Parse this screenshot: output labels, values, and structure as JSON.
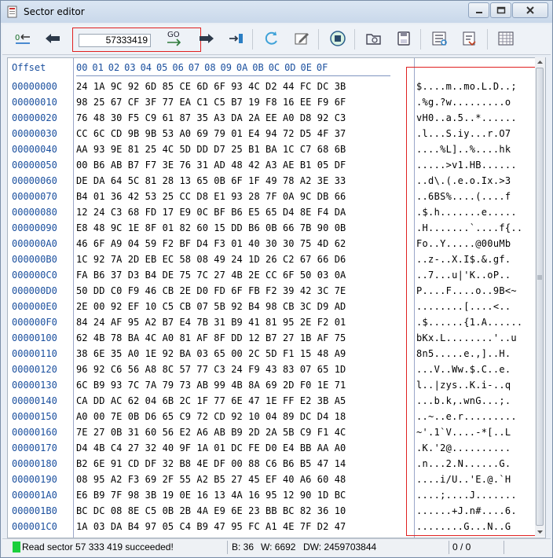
{
  "window": {
    "title": "Sector editor"
  },
  "toolbar": {
    "sector_value": "57333419",
    "go_label": "GO"
  },
  "grid": {
    "offset_header": "Offset",
    "column_headers": [
      "00",
      "01",
      "02",
      "03",
      "04",
      "05",
      "06",
      "07",
      "08",
      "09",
      "0A",
      "0B",
      "0C",
      "0D",
      "0E",
      "0F"
    ],
    "rows": [
      {
        "offset": "00000000",
        "hex": "24 1A 9C 92 6D 85 CE 6D 6F 93 4C D2 44 FC DC 3B",
        "ascii": "$....m..mo.L.D..;"
      },
      {
        "offset": "00000010",
        "hex": "98 25 67 CF 3F 77 EA C1 C5 B7 19 F8 16 EE F9 6F",
        "ascii": ".%g.?w.........o"
      },
      {
        "offset": "00000020",
        "hex": "76 48 30 F5 C9 61 87 35 A3 DA 2A EE A0 D8 92 C3",
        "ascii": "vH0..a.5..*......"
      },
      {
        "offset": "00000030",
        "hex": "CC 6C CD 9B 9B 53 A0 69 79 01 E4 94 72 D5 4F 37",
        "ascii": ".l...S.iy...r.O7"
      },
      {
        "offset": "00000040",
        "hex": "AA 93 9E 81 25 4C 5D DD D7 25 B1 BA 1C C7 68 6B",
        "ascii": "....%L]..%....hk"
      },
      {
        "offset": "00000050",
        "hex": "00 B6 AB B7 F7 3E 76 31 AD 48 42 A3 AE B1 05 DF",
        "ascii": ".....>v1.HB......"
      },
      {
        "offset": "00000060",
        "hex": "DE DA 64 5C 81 28 13 65 0B 6F 1F 49 78 A2 3E 33",
        "ascii": "..d\\.(.e.o.Ix.>3"
      },
      {
        "offset": "00000070",
        "hex": "B4 01 36 42 53 25 CC D8 E1 93 28 7F 0A 9C DB 66",
        "ascii": "..6BS%....(....f"
      },
      {
        "offset": "00000080",
        "hex": "12 24 C3 68 FD 17 E9 0C BF B6 E5 65 D4 8E F4 DA",
        "ascii": ".$.h.......e....."
      },
      {
        "offset": "00000090",
        "hex": "E8 48 9C 1E 8F 01 82 60 15 DD B6 0B 66 7B 90 0B",
        "ascii": ".H.......`....f{.."
      },
      {
        "offset": "000000A0",
        "hex": "46 6F A9 04 59 F2 BF D4 F3 01 40 30 30 75 4D 62",
        "ascii": "Fo..Y.....@00uMb"
      },
      {
        "offset": "000000B0",
        "hex": "1C 92 7A 2D EB EC 58 08 49 24 1D 26 C2 67 66 D6",
        "ascii": "..z-..X.I$.&.gf."
      },
      {
        "offset": "000000C0",
        "hex": "FA B6 37 D3 B4 DE 75 7C 27 4B 2E CC 6F 50 03 0A",
        "ascii": "..7...u|'K..oP.."
      },
      {
        "offset": "000000D0",
        "hex": "50 DD C0 F9 46 CB 2E D0 FD 6F FB F2 39 42 3C 7E",
        "ascii": "P....F....o..9B<~"
      },
      {
        "offset": "000000E0",
        "hex": "2E 00 92 EF 10 C5 CB 07 5B 92 B4 98 CB 3C D9 AD",
        "ascii": "........[....<.."
      },
      {
        "offset": "000000F0",
        "hex": "84 24 AF 95 A2 B7 E4 7B 31 B9 41 81 95 2E F2 01",
        "ascii": ".$......{1.A......"
      },
      {
        "offset": "00000100",
        "hex": "62 4B 78 BA 4C A0 81 AF 8F DD 12 B7 27 1B AF 75",
        "ascii": "bKx.L........'..u"
      },
      {
        "offset": "00000110",
        "hex": "38 6E 35 A0 1E 92 BA 03 65 00 2C 5D F1 15 48 A9",
        "ascii": "8n5.....e.,]..H."
      },
      {
        "offset": "00000120",
        "hex": "96 92 C6 56 A8 8C 57 77 C3 24 F9 43 83 07 65 1D",
        "ascii": "...V..Ww.$.C..e."
      },
      {
        "offset": "00000130",
        "hex": "6C B9 93 7C 7A 79 73 AB 99 4B 8A 69 2D F0 1E 71",
        "ascii": "l..|zys..K.i-..q"
      },
      {
        "offset": "00000140",
        "hex": "CA DD AC 62 04 6B 2C 1F 77 6E 47 1E FF E2 3B A5",
        "ascii": "...b.k,.wnG...;."
      },
      {
        "offset": "00000150",
        "hex": "A0 00 7E 0B D6 65 C9 72 CD 92 10 04 89 DC D4 18",
        "ascii": "..~..e.r........."
      },
      {
        "offset": "00000160",
        "hex": "7E 27 0B 31 60 56 E2 A6 AB B9 2D 2A 5B C9 F1 4C",
        "ascii": "~'.1`V....-*[..L"
      },
      {
        "offset": "00000170",
        "hex": "D4 4B C4 27 32 40 9F 1A 01 DC FE D0 E4 BB AA A0",
        "ascii": ".K.'2@.........."
      },
      {
        "offset": "00000180",
        "hex": "B2 6E 91 CD DF 32 B8 4E DF 00 88 C6 B6 B5 47 14",
        "ascii": ".n...2.N......G."
      },
      {
        "offset": "00000190",
        "hex": "08 95 A2 F3 69 2F 55 A2 B5 27 45 EF 40 A6 60 48",
        "ascii": "....i/U..'E.@.`H"
      },
      {
        "offset": "000001A0",
        "hex": "E6 B9 7F 98 3B 19 0E 16 13 4A 16 95 12 90 1D BC",
        "ascii": "....;....J......."
      },
      {
        "offset": "000001B0",
        "hex": "BC DC 08 8E C5 0B 2B 4A E9 6E 23 BB BC 82 36 10",
        "ascii": "......+J.n#....6."
      },
      {
        "offset": "000001C0",
        "hex": "1A 03 DA B4 97 05 C4 B9 47 95 FC A1 4E 7F D2 47",
        "ascii": "........G...N..G"
      }
    ]
  },
  "status": {
    "message": "Read sector 57 333 419 succeeded!",
    "byte": "B: 36",
    "word": "W: 6692",
    "dword": "DW: 2459703844",
    "position": "0 / 0",
    "indicator_color": "#1bcf3c"
  },
  "colors": {
    "offset_text": "#1a4f9e",
    "highlight_border": "#e02020"
  }
}
